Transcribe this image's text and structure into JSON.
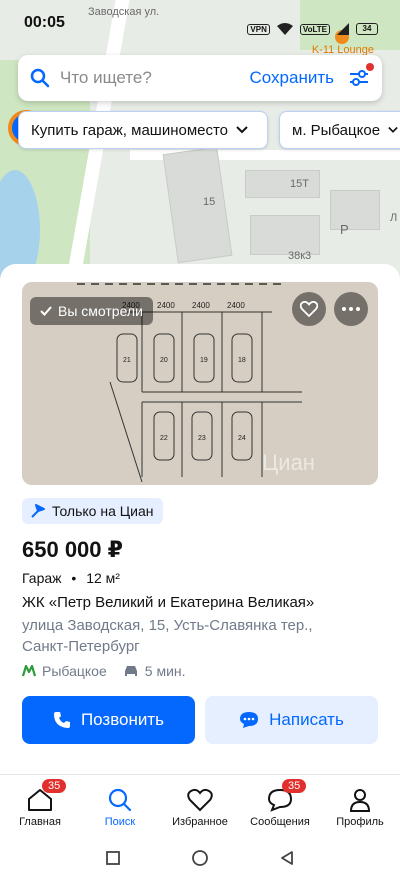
{
  "status_bar": {
    "time": "00:05",
    "vpn": "VPN",
    "volte": "VoLTE",
    "battery": "34"
  },
  "map": {
    "street_label": "Заводская ул.",
    "poi_label": "K-11 Lounge",
    "house_labels": [
      "15",
      "15Т",
      "38к3",
      "P",
      "Л"
    ],
    "colors": {
      "park": "#cfe6c2",
      "water": "#a7d2ec"
    }
  },
  "search": {
    "placeholder": "Что ищете?",
    "save_label": "Сохранить",
    "search_icon": "search-icon",
    "filter_icon": "filter-icon"
  },
  "filters": {
    "deal_chip": "Купить гараж, машиноместо",
    "metro_chip": "м. Рыбацкое"
  },
  "listing": {
    "seen_label": "Вы смотрели",
    "photo_watermark": "Циан",
    "badge": "Только на Циан",
    "price": "650 000 ₽",
    "type": "Гараж",
    "separator": "•",
    "area": "12 м²",
    "title": "ЖК «Петр Великий и Екатерина Великая»",
    "address": "улица Заводская, 15, Усть-Славянка тер., Санкт-Петербург",
    "metro": "Рыбацкое",
    "travel_time": "5 мин.",
    "call_label": "Позвонить",
    "message_label": "Написать",
    "plan_numbers": [
      "2400",
      "2400",
      "2400",
      "2400",
      "21",
      "20",
      "19",
      "18",
      "22",
      "23",
      "24"
    ],
    "accent_color": "#0468ff"
  },
  "nav": {
    "items": [
      {
        "label": "Главная",
        "icon": "home-icon",
        "badge": "35"
      },
      {
        "label": "Поиск",
        "icon": "search-icon",
        "badge": ""
      },
      {
        "label": "Избранное",
        "icon": "heart-icon",
        "badge": ""
      },
      {
        "label": "Сообщения",
        "icon": "chat-icon",
        "badge": "35"
      },
      {
        "label": "Профиль",
        "icon": "profile-icon",
        "badge": ""
      }
    ],
    "active": "Поиск"
  }
}
